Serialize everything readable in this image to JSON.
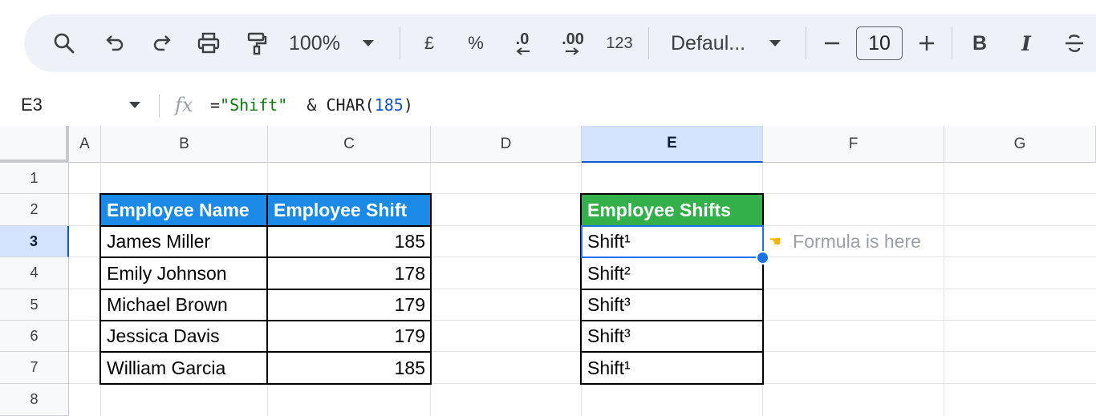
{
  "toolbar": {
    "zoom": "100%",
    "currency": "£",
    "percent": "%",
    "decrease_decimal": ".0",
    "increase_decimal": ".00",
    "number_format": "123",
    "font": "Defaul...",
    "font_size": "10",
    "bold": "B",
    "italic": "I"
  },
  "formula_bar": {
    "name_box": "E3",
    "formula_parts": {
      "eq": "=",
      "str": "\"Shift\"",
      "amp": "  & CHAR(",
      "num": "185",
      "close": ")"
    }
  },
  "columns": [
    "A",
    "B",
    "C",
    "D",
    "E",
    "F",
    "G"
  ],
  "rows": [
    "1",
    "2",
    "3",
    "4",
    "5",
    "6",
    "7",
    "8"
  ],
  "selected": {
    "column": "E",
    "row": "3"
  },
  "table1": {
    "headers": [
      "Employee Name",
      "Employee Shift"
    ],
    "rows": [
      [
        "James Miller",
        "185"
      ],
      [
        "Emily Johnson",
        "178"
      ],
      [
        "Michael Brown",
        "179"
      ],
      [
        "Jessica Davis",
        "179"
      ],
      [
        "William Garcia",
        "185"
      ]
    ]
  },
  "table2": {
    "header": "Employee Shifts",
    "rows": [
      "Shift¹",
      "Shift²",
      "Shift³",
      "Shift³",
      "Shift¹"
    ]
  },
  "annotation": {
    "text": "Formula is here"
  },
  "colors": {
    "header_blue": "#1a8ae6",
    "header_green": "#34b04a",
    "selection": "#1a73e8",
    "selected_header": "#d3e3fd"
  }
}
